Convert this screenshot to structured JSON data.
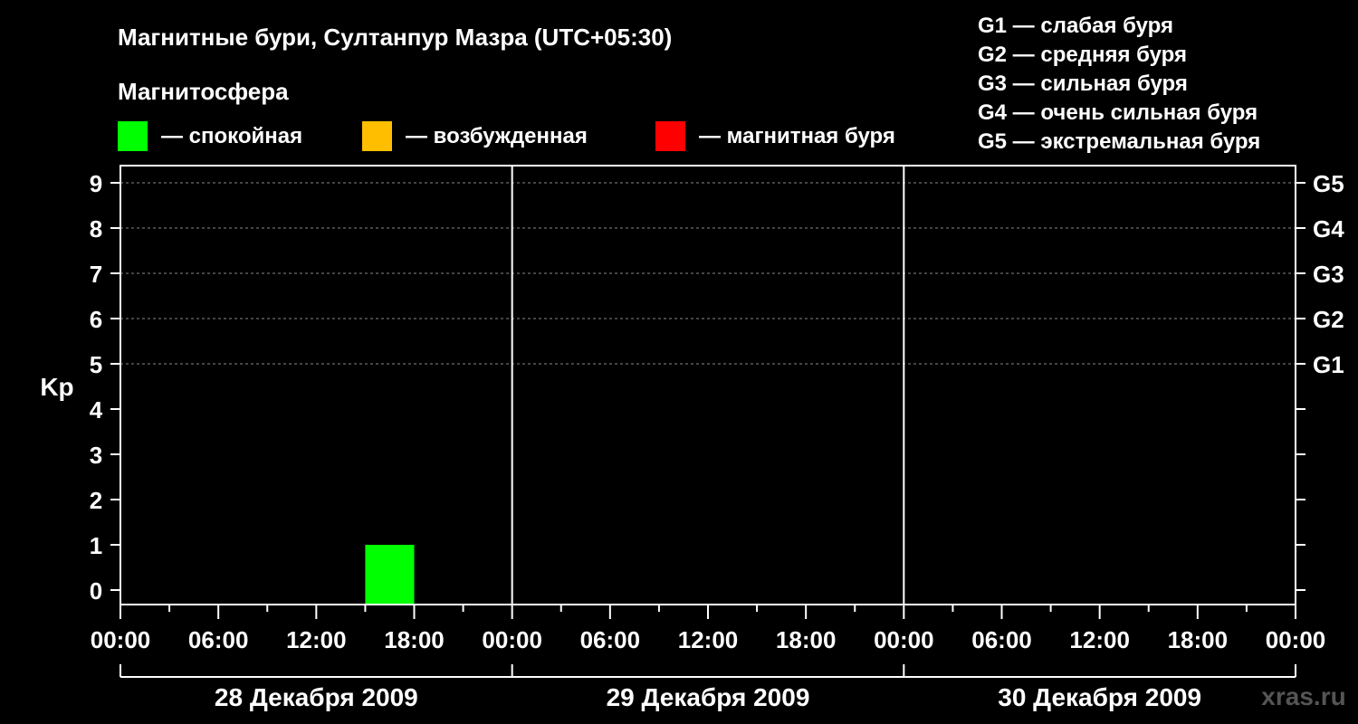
{
  "chart_data": {
    "type": "bar",
    "title": "Магнитные бури, Султанпур Мазра (UTC+05:30)",
    "legend_title": "Магнитосфера",
    "legend": [
      {
        "color": "#00ff00",
        "label": "— спокойная"
      },
      {
        "color": "#ffbf00",
        "label": "— возбужденная"
      },
      {
        "color": "#ff0000",
        "label": "— магнитная буря"
      }
    ],
    "g_legend": [
      "G1 — слабая буря",
      "G2 — средняя буря",
      "G3 — сильная буря",
      "G4 — очень сильная буря",
      "G5 — экстремальная буря"
    ],
    "ylabel": "Kp",
    "ylim": [
      0,
      9
    ],
    "y_ticks": [
      "0",
      "1",
      "2",
      "3",
      "4",
      "5",
      "6",
      "7",
      "8",
      "9"
    ],
    "g_levels": [
      {
        "kp": 5,
        "label": "G1"
      },
      {
        "kp": 6,
        "label": "G2"
      },
      {
        "kp": 7,
        "label": "G3"
      },
      {
        "kp": 8,
        "label": "G4"
      },
      {
        "kp": 9,
        "label": "G5"
      }
    ],
    "x_ticks": [
      "00:00",
      "06:00",
      "12:00",
      "18:00",
      "00:00",
      "06:00",
      "12:00",
      "18:00",
      "00:00",
      "06:00",
      "12:00",
      "18:00",
      "00:00"
    ],
    "days": [
      "28 Декабря 2009",
      "29 Декабря 2009",
      "30 Декабря 2009"
    ],
    "bars": [
      {
        "day": "28 Декабря 2009",
        "start": "15:00",
        "end": "18:00",
        "kp": 1,
        "color": "#00ff00"
      }
    ],
    "grid": "dashed horizontal lines at Kp 5–9"
  },
  "watermark": "xras.ru"
}
